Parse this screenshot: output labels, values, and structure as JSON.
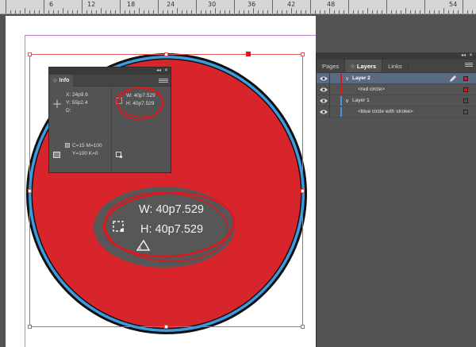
{
  "ruler": {
    "labels": [
      "6",
      "12",
      "18",
      "24",
      "30",
      "36",
      "42",
      "48",
      "54"
    ]
  },
  "info_panel": {
    "tab_label": "Info",
    "x": "X: 24p9.6",
    "y": "Y: 55p2.4",
    "d": "D:",
    "w": "W: 40p7.529",
    "h": "H: 40p7.529",
    "color_line1": "C=15 M=100",
    "color_line2": "Y=100 K=0"
  },
  "zoom": {
    "w": "W: 40p7.529",
    "h": "H: 40p7.529"
  },
  "layers_panel": {
    "tabs": [
      {
        "label": "Pages",
        "active": false
      },
      {
        "label": "Layers",
        "active": true
      },
      {
        "label": "Links",
        "active": false
      }
    ],
    "rows": [
      {
        "name": "Layer 2",
        "type": "layer",
        "selected": true,
        "color": "#e0161d"
      },
      {
        "name": "<red circle>",
        "type": "item",
        "selected": false,
        "color": "#e0161d"
      },
      {
        "name": "Layer 1",
        "type": "layer",
        "selected": false,
        "color": "#4d90e8"
      },
      {
        "name": "<blue circle with stroke>",
        "type": "item",
        "selected": false,
        "color": "#4d90e8"
      }
    ]
  },
  "colors": {
    "red_fill": "#d7252b",
    "blue_stroke": "#3e9be0",
    "black_stroke": "#111111",
    "selection": "#e05555",
    "margin_guide": "#c77fd6",
    "panel_bg": "#535353",
    "pasteboard": "#545454"
  }
}
